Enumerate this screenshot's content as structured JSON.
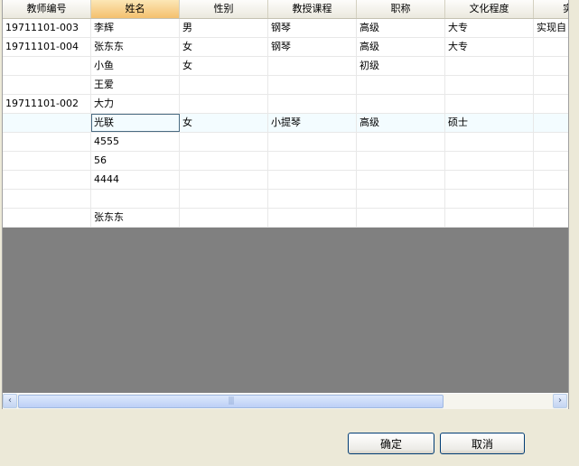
{
  "grid": {
    "columns": [
      "教师编号",
      "姓名",
      "性别",
      "教授课程",
      "职称",
      "文化程度",
      "实现自"
    ],
    "rows": [
      [
        "19711101-003",
        "李辉",
        "男",
        "钢琴",
        "高级",
        "大专",
        "实现自"
      ],
      [
        "19711101-004",
        "张东东",
        "女",
        "钢琴",
        "高级",
        "大专",
        ""
      ],
      [
        "",
        "小鱼",
        "女",
        "",
        "初级",
        "",
        ""
      ],
      [
        "",
        "王爱",
        "",
        "",
        "",
        "",
        ""
      ],
      [
        "19711101-002",
        "大力",
        "",
        "",
        "",
        "",
        ""
      ],
      [
        "",
        "光联",
        "女",
        "小提琴",
        "高级",
        "硕士",
        ""
      ],
      [
        "",
        "4555",
        "",
        "",
        "",
        "",
        ""
      ],
      [
        "",
        "56",
        "",
        "",
        "",
        "",
        ""
      ],
      [
        "",
        "4444",
        "",
        "",
        "",
        "",
        ""
      ],
      [
        "",
        "",
        "",
        "",
        "",
        "",
        ""
      ],
      [
        "",
        "张东东",
        "",
        "",
        "",
        "",
        ""
      ]
    ],
    "selected_row": 5,
    "focused_column": 1,
    "active_header": 1
  },
  "scrollbar": {
    "left_arrow": "‹",
    "right_arrow": "›",
    "thumb_grip": "|||"
  },
  "buttons": {
    "ok_label": "确定",
    "cancel_label": "取消"
  }
}
